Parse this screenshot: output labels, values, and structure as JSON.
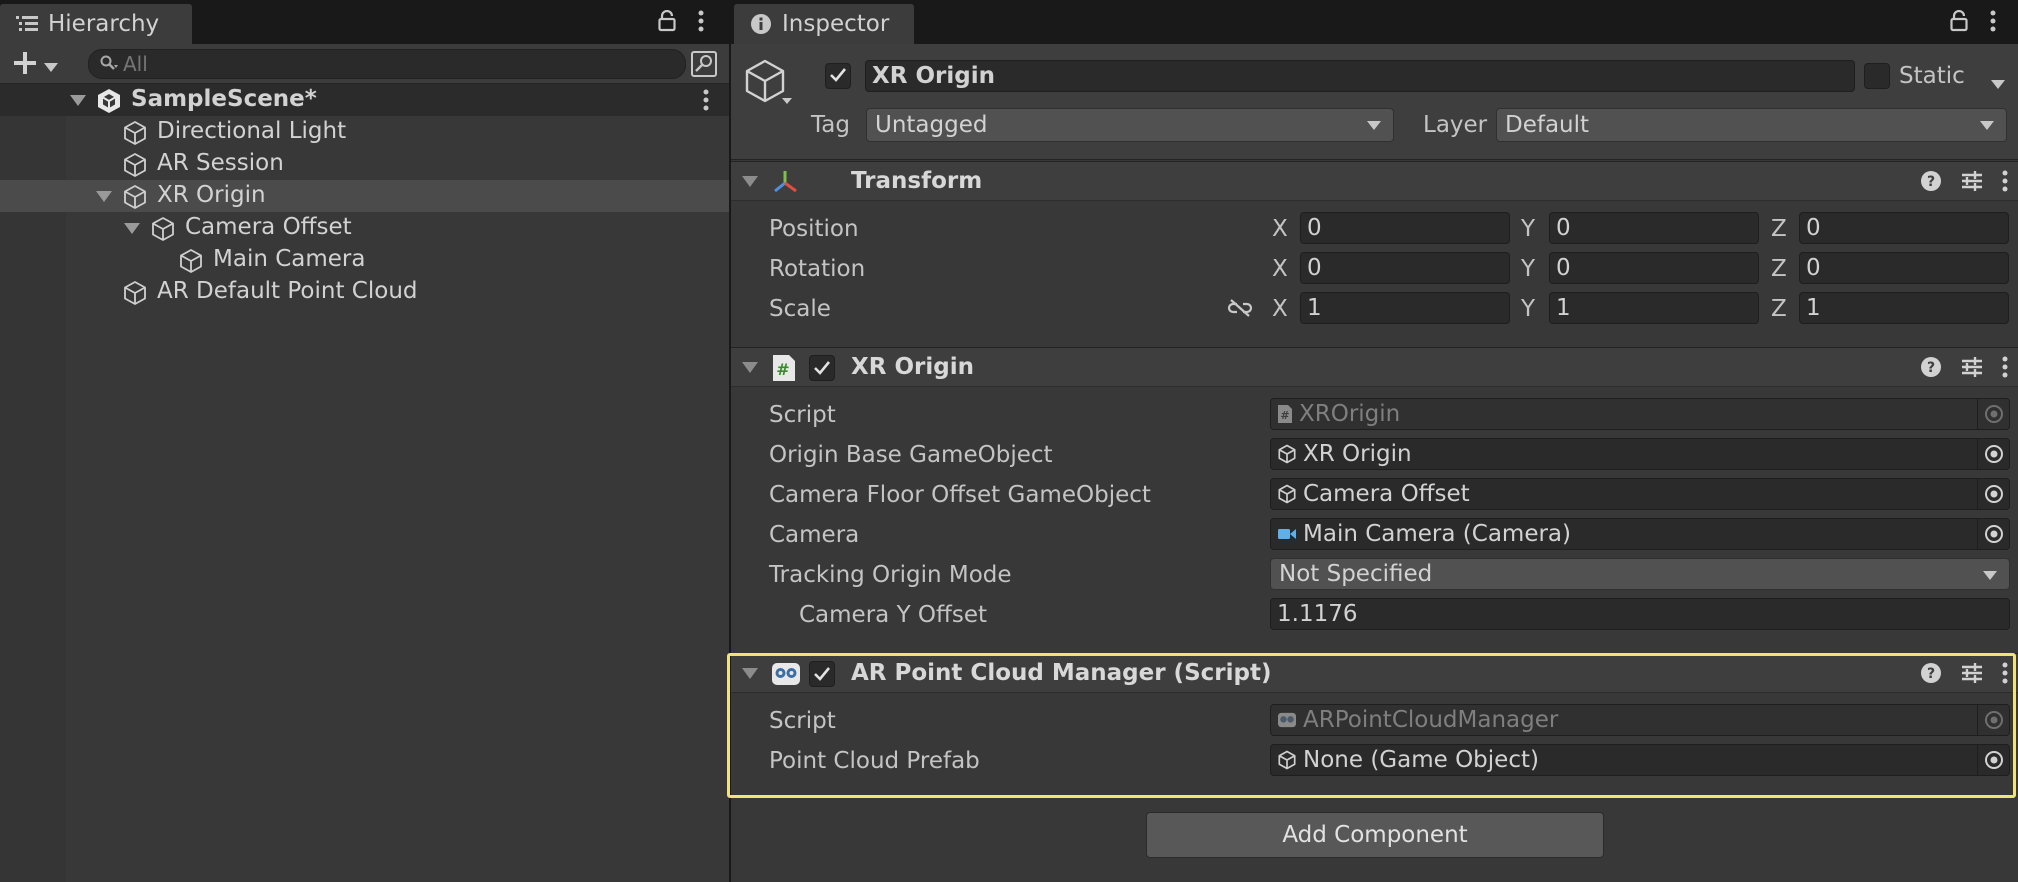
{
  "hierarchy": {
    "tab_label": "Hierarchy",
    "search": {
      "placeholder": "All",
      "value": ""
    },
    "scene_name": "SampleScene*",
    "items": [
      {
        "label": "Directional Light"
      },
      {
        "label": "AR Session"
      },
      {
        "label": "XR Origin"
      },
      {
        "label": "Camera Offset"
      },
      {
        "label": "Main Camera"
      },
      {
        "label": "AR Default Point Cloud"
      }
    ],
    "selected_item": "XR Origin"
  },
  "inspector": {
    "tab_label": "Inspector",
    "object": {
      "active": true,
      "name": "XR Origin",
      "static_label": "Static",
      "static": false,
      "tag_label": "Tag",
      "tag_value": "Untagged",
      "layer_label": "Layer",
      "layer_value": "Default"
    },
    "transform": {
      "title": "Transform",
      "position": {
        "label": "Position",
        "x_label": "X",
        "y_label": "Y",
        "z_label": "Z",
        "x": "0",
        "y": "0",
        "z": "0"
      },
      "rotation": {
        "label": "Rotation",
        "x_label": "X",
        "y_label": "Y",
        "z_label": "Z",
        "x": "0",
        "y": "0",
        "z": "0"
      },
      "scale": {
        "label": "Scale",
        "x_label": "X",
        "y_label": "Y",
        "z_label": "Z",
        "x": "1",
        "y": "1",
        "z": "1"
      }
    },
    "xr_origin": {
      "title": "XR Origin",
      "enabled": true,
      "script_label": "Script",
      "script_value": "XROrigin",
      "origin_base_label": "Origin Base GameObject",
      "origin_base_value": "XR Origin",
      "camera_floor_label": "Camera Floor Offset GameObject",
      "camera_floor_value": "Camera Offset",
      "camera_label": "Camera",
      "camera_value": "Main Camera (Camera)",
      "tracking_mode_label": "Tracking Origin Mode",
      "tracking_mode_value": "Not Specified",
      "camera_y_offset_label": "Camera Y Offset",
      "camera_y_offset_value": "1.1176"
    },
    "ar_point_cloud_manager": {
      "title": "AR Point Cloud Manager (Script)",
      "enabled": true,
      "script_label": "Script",
      "script_value": "ARPointCloudManager",
      "prefab_label": "Point Cloud Prefab",
      "prefab_value": "None (Game Object)"
    },
    "add_component_label": "Add Component"
  },
  "colors": {
    "highlight": "#f2e27a",
    "panel": "#383838",
    "field": "#2a2a2a"
  }
}
